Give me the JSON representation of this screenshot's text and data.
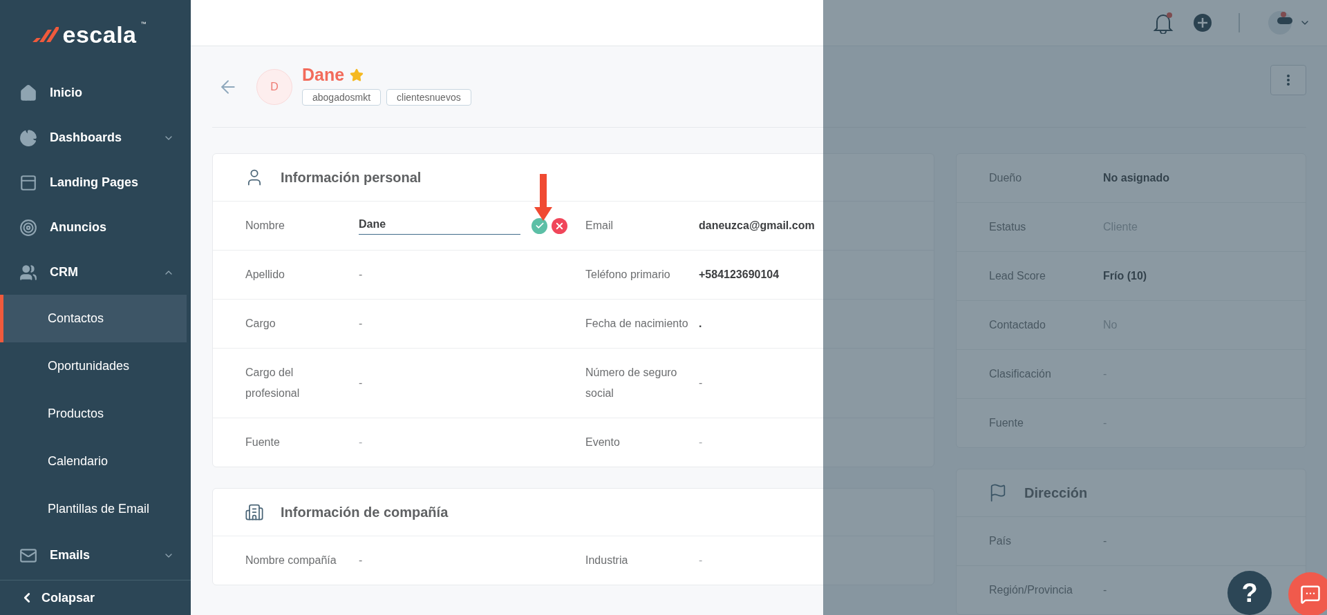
{
  "sidebar": {
    "logo": {
      "name": "escala",
      "mark": "™"
    },
    "items": [
      {
        "label": "Inicio",
        "kind": "link"
      },
      {
        "label": "Dashboards",
        "kind": "group",
        "expanded": false
      },
      {
        "label": "Landing Pages",
        "kind": "link"
      },
      {
        "label": "Anuncios",
        "kind": "link"
      },
      {
        "label": "CRM",
        "kind": "group",
        "expanded": true,
        "children": [
          {
            "label": "Contactos",
            "selected": true
          },
          {
            "label": "Oportunidades",
            "selected": false
          },
          {
            "label": "Productos",
            "selected": false
          },
          {
            "label": "Calendario",
            "selected": false
          },
          {
            "label": "Plantillas de Email",
            "selected": false
          }
        ]
      },
      {
        "label": "Emails",
        "kind": "group",
        "expanded": false
      }
    ],
    "collapse": "Colapsar"
  },
  "contact": {
    "initial": "D",
    "name": "Dane",
    "starred": true,
    "tags": [
      "abogadosmkt",
      "clientesnuevos"
    ]
  },
  "personal": {
    "title": "Información personal",
    "fields": [
      {
        "label": "Nombre",
        "value": "Dane",
        "kind": "input"
      },
      {
        "label": "Email",
        "value": "daneuzca@gmail.com",
        "kind": "filled"
      },
      {
        "label": "Apellido",
        "value": "-",
        "kind": "empty"
      },
      {
        "label": "Teléfono primario",
        "value": "+584123690104",
        "kind": "filled"
      },
      {
        "label": "Cargo",
        "value": "-",
        "kind": "empty"
      },
      {
        "label": "Fecha de nacimiento",
        "value": ".",
        "kind": "filled"
      },
      {
        "label": "Cargo del profesional",
        "value": "-",
        "kind": "empty"
      },
      {
        "label": "Número de seguro social",
        "value": "-",
        "kind": "empty"
      },
      {
        "label": "Fuente",
        "value": "-",
        "kind": "faint"
      },
      {
        "label": "Evento",
        "value": "-",
        "kind": "faint"
      }
    ]
  },
  "company": {
    "title": "Información de compañía",
    "fields": [
      {
        "label": "Nombre compañía",
        "value": "-",
        "kind": "empty"
      },
      {
        "label": "Industria",
        "value": "-",
        "kind": "faint"
      }
    ]
  },
  "summary": {
    "fields": [
      {
        "label": "Dueño",
        "value": "No asignado",
        "kind": "filled"
      },
      {
        "label": "Estatus",
        "value": "Cliente",
        "kind": "faint"
      },
      {
        "label": "Lead Score",
        "value": "Frío (10)",
        "kind": "filled"
      },
      {
        "label": "Contactado",
        "value": "No",
        "kind": "faint"
      },
      {
        "label": "Clasificación",
        "value": "-",
        "kind": "faint"
      },
      {
        "label": "Fuente",
        "value": "-",
        "kind": "faint"
      }
    ]
  },
  "address": {
    "title": "Dirección",
    "fields": [
      {
        "label": "País",
        "value": "-",
        "kind": "empty"
      },
      {
        "label": "Región/Provincia",
        "value": "-",
        "kind": "empty"
      }
    ]
  },
  "help_button": {
    "label": "?"
  }
}
